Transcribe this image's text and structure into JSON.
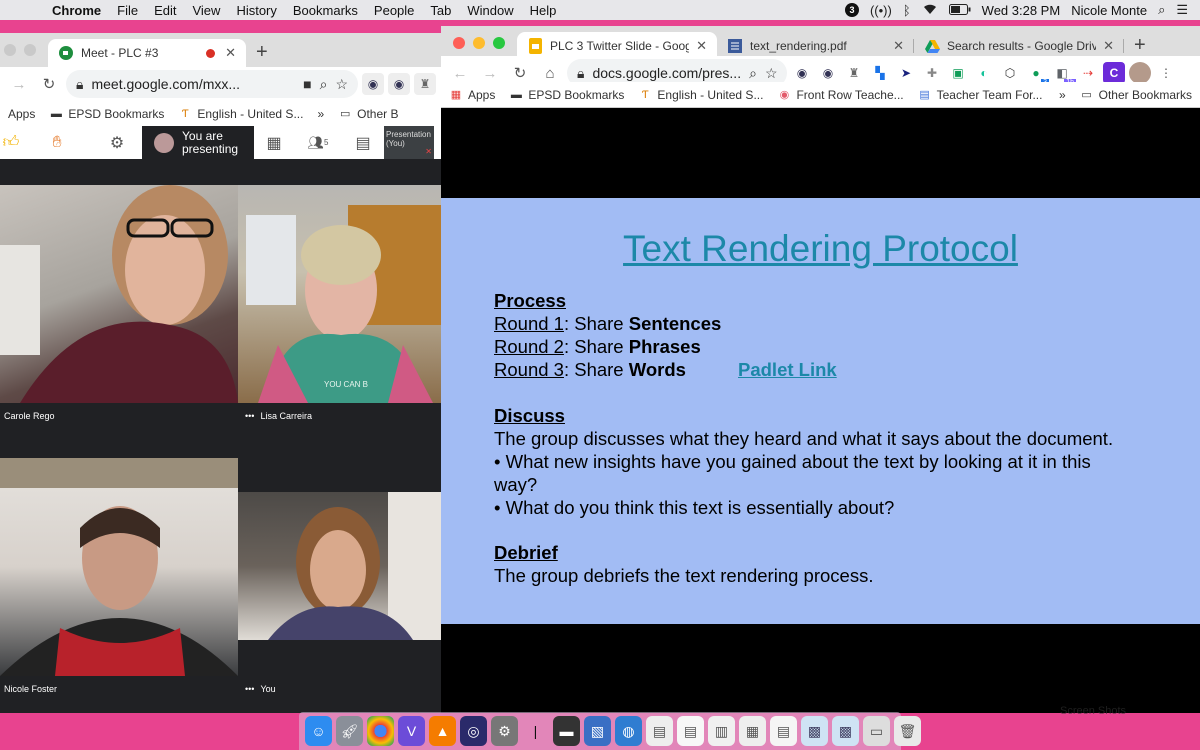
{
  "menubar": {
    "app": "Chrome",
    "items": [
      "File",
      "Edit",
      "View",
      "History",
      "Bookmarks",
      "People",
      "Tab",
      "Window",
      "Help"
    ],
    "badge": "3",
    "clock": "Wed 3:28 PM",
    "user": "Nicole Monte"
  },
  "meet": {
    "tab_title": "Meet - PLC #3",
    "url": "meet.google.com/mxx...",
    "bookmarks": [
      "Apps",
      "EPSD Bookmarks",
      "English - United S...",
      "Other B"
    ],
    "presenting_text": "You are presenting",
    "presentation_tile": "Presentation (You)",
    "participants_count": "5",
    "participants": [
      {
        "name": "Carole Rego"
      },
      {
        "name": "Lisa Carreira",
        "speaking": true,
        "shirt_text": "YOU CAN B"
      },
      {
        "name": "Nicole Foster"
      },
      {
        "name": "You",
        "speaking": true
      }
    ]
  },
  "docs": {
    "tabs": [
      {
        "title": "PLC 3 Twitter Slide - Google Sl",
        "active": true
      },
      {
        "title": "text_rendering.pdf"
      },
      {
        "title": "Search results - Google Drive"
      }
    ],
    "url_host": "docs.google.com/pres...",
    "extension_badges": [
      "3",
      "1h"
    ],
    "bookmarks": [
      "Apps",
      "EPSD Bookmarks",
      "English - United S...",
      "Front Row Teache...",
      "Teacher Team For...",
      "Other Bookmarks"
    ]
  },
  "slide": {
    "title": "Text Rendering Protocol",
    "process_heading": "Process",
    "rounds": [
      {
        "round": "Round 1",
        "prefix": ": Share ",
        "bold": "Sentences"
      },
      {
        "round": "Round 2",
        "prefix": ": Share ",
        "bold": "Phrases"
      },
      {
        "round": "Round 3",
        "prefix": ": Share ",
        "bold": "Words"
      }
    ],
    "padlet_link": "Padlet Link",
    "discuss_heading": "Discuss",
    "discuss_text": "The group discusses what they heard and what it says about the document.",
    "bullet1_line1": "• What new insights have you gained about the text by looking at it in this",
    "bullet1_line2": "way?",
    "bullet2": "• What do you think this text is essentially about?",
    "debrief_heading": "Debrief",
    "debrief_text": "The group debriefs the text rendering process."
  },
  "desktop": {
    "screenshots_label": "Screen Shots"
  }
}
